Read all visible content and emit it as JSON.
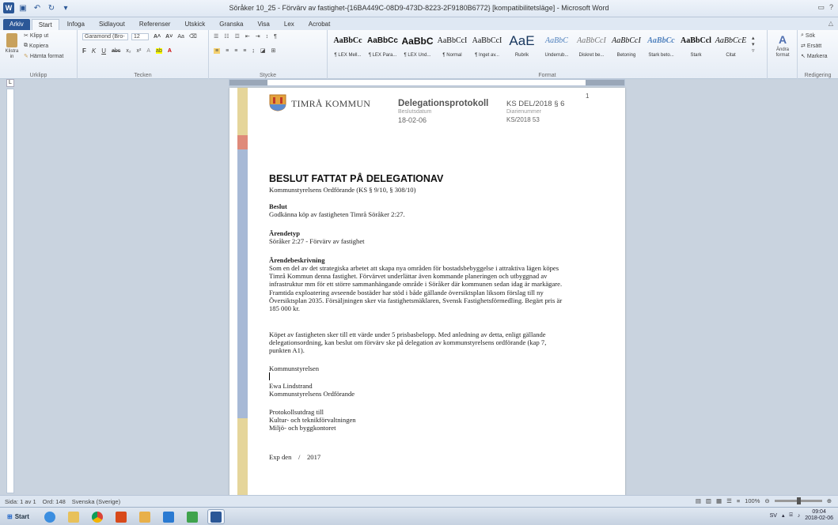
{
  "window": {
    "title": "Söråker 10_25 - Förvärv av fastighet-{16BA449C-08D9-473D-8223-2F9180B6772} [kompatibilitetsläge] - Microsoft Word",
    "word_icon": "W"
  },
  "tabs": [
    "Arkiv",
    "Start",
    "Infoga",
    "Sidlayout",
    "Referenser",
    "Utskick",
    "Granska",
    "Visa",
    "Lex",
    "Acrobat"
  ],
  "ribbon": {
    "clipboard": {
      "paste": "Klistra in",
      "cut": "Klipp ut",
      "copy": "Kopiera",
      "format_painter": "Hämta format",
      "label": "Urklipp"
    },
    "font": {
      "name": "Garamond (Bro-",
      "size": "12",
      "label": "Tecken"
    },
    "paragraph": {
      "label": "Stycke"
    },
    "styles": {
      "label": "Format",
      "items": [
        {
          "sample": "AaBbCc",
          "name": "¶ LEX Mell..."
        },
        {
          "sample": "AaBbCc",
          "name": "¶ LEX Para..."
        },
        {
          "sample": "AaBbC",
          "name": "¶ LEX Und..."
        },
        {
          "sample": "AaBbCcI",
          "name": "¶ Normal"
        },
        {
          "sample": "AaBbCcI",
          "name": "¶ Inget av..."
        },
        {
          "sample": "AaE",
          "name": "Rubrik"
        },
        {
          "sample": "AaBbC",
          "name": "Underrub..."
        },
        {
          "sample": "AaBbCcI",
          "name": "Diskret be..."
        },
        {
          "sample": "AaBbCcI",
          "name": "Betoning"
        },
        {
          "sample": "AaBbCc",
          "name": "Stark beto..."
        },
        {
          "sample": "AaBbCcl",
          "name": "Stark"
        },
        {
          "sample": "AaBbCcE",
          "name": "Citat"
        }
      ],
      "change": "Ändra format"
    },
    "editing": {
      "find": "Sök",
      "replace": "Ersätt",
      "select": "Markera",
      "label": "Redigering"
    }
  },
  "document": {
    "org": "TIMRÅ KOMMUN",
    "protocol_title": "Delegationsprotokoll",
    "ks_number": "KS DEL/2018 § 6",
    "beslutsdatum_label": "Beslutsdatum",
    "beslutsdatum": "18-02-06",
    "dnr_label": "Diarienummer",
    "dnr": "KS/2018 53",
    "page_number": "1",
    "heading": "BESLUT FATTAT PÅ DELEGATIONAV",
    "subheading": "Kommunstyrelsens Ordförande (KS § 9/10, § 308/10)",
    "beslut_label": "Beslut",
    "beslut_text": "Godkänna köp av fastigheten Timrå Söråker 2:27.",
    "arendetyp_label": "Ärendetyp",
    "arendetyp_text": "Söråker 2:27 - Förvärv av fastighet",
    "beskrivning_label": "Ärendebeskrivning",
    "beskrivning_p1": "Som en del av det strategiska arbetet att skapa nya områden för bostadsbebyggelse i attraktiva lägen köpes Timrå Kommun denna fastighet. Förvärvet underlättar även kommande planeringen och utbyggnad av infrastruktur mm för ett större sammanhängande område i Söråker där kommunen sedan idag är markägare. Framtida exploatering avseende bostäder har stöd i både gällande översiktsplan liksom förslag till ny Översiktsplan 2035. Försäljningen sker via fastighetsmäklaren, Svensk Fastighetsförmedling. Begärt pris är 185 000 kr.",
    "beskrivning_p2": "Köpet av fastigheten sker till ett värde under 5 prisbasbelopp. Med anledning av detta, enligt gällande delegationsordning, kan beslut om förvärv ske på delegation av kommunstyrelsens ordförande (kap 7, punkten A1).",
    "signer_org": "Kommunstyrelsen",
    "signer_name": "Ewa Lindstrand",
    "signer_title": "Kommunstyrelsens Ordförande",
    "extract_label": "Protokollsutdrag till",
    "extract_1": "Kultur- och teknikförvaltningen",
    "extract_2": "Miljö- och byggkontoret",
    "exp": "Exp den    /    2017"
  },
  "statusbar": {
    "page": "Sida: 1 av 1",
    "words": "Ord: 148",
    "language": "Svenska (Sverige)",
    "zoom": "100%"
  },
  "taskbar": {
    "start": "Start",
    "lang": "SV",
    "time": "09:04",
    "date": "2018-02-06"
  },
  "colors": {
    "accent": "#2b5797",
    "stripe_yellow": "#e5d59a",
    "stripe_blue": "#a7b9d6",
    "stripe_red": "#df8a7a"
  }
}
